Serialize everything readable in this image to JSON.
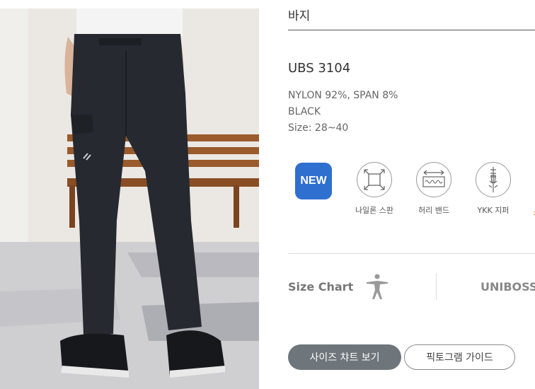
{
  "product": {
    "category": "바지",
    "model": "UBS 3104",
    "material": "NYLON 92%, SPAN 8%",
    "color": "BLACK",
    "size": "Size: 28~40"
  },
  "features": {
    "new_badge": "NEW",
    "items": [
      {
        "icon": "stretch-arrows-icon",
        "label": "나일론 스판"
      },
      {
        "icon": "waist-band-icon",
        "label": "허리 밴드"
      },
      {
        "icon": "zipper-icon",
        "label": "YKK 지퍼"
      }
    ]
  },
  "size_chart": {
    "label": "Size Chart",
    "brand": "UNIBOSS"
  },
  "buttons": {
    "size_chart": "사이즈 챠트 보기",
    "pictogram": "픽토그램 가이드"
  },
  "colors": {
    "badge_blue": "#2f6fcf",
    "dark_button": "#6e757b"
  }
}
